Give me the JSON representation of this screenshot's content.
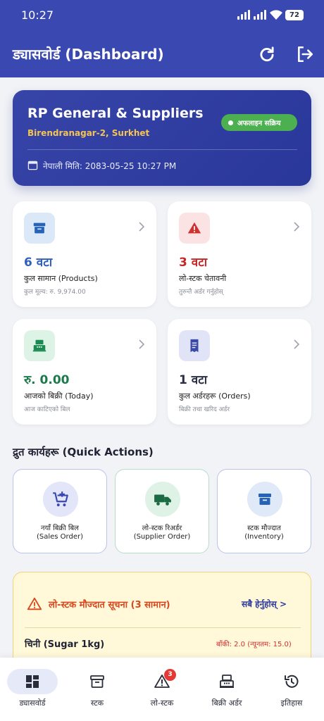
{
  "status_bar": {
    "time": "10:27",
    "battery": "72"
  },
  "header": {
    "title": "ड्यासवोर्ड (Dashboard)",
    "refresh_icon": "refresh-icon",
    "logout_icon": "logout-icon"
  },
  "business": {
    "name": "RP General & Suppliers",
    "address": "Birendranagar-2, Surkhet",
    "status": "अफलाइन सक्रिय",
    "date_label": "नेपाली मिति: 2083-05-25 10:27 PM"
  },
  "stats": [
    {
      "value": "6 वटा",
      "label": "कुल सामान (Products)",
      "sub": "कुल मूल्य: रु. 9,974.00",
      "color": "#2f5fb8",
      "icon": "archive-icon"
    },
    {
      "value": "3 वटा",
      "label": "लो-स्टक चेतावनी",
      "sub": "तुरुन्तै अर्डर गर्नुहोस्",
      "color": "#c62828",
      "icon": "warning-icon"
    },
    {
      "value": "रु. 0.00",
      "label": "आजको बिक्री (Today)",
      "sub": "आज काटिएको बिल",
      "color": "#1b7a4a",
      "icon": "cash-register-icon"
    },
    {
      "value": "1 वटा",
      "label": "कुल अर्डरहरू (Orders)",
      "sub": "बिक्री तथा खरिद अर्डर",
      "color": "#2a2f45",
      "icon": "receipt-icon"
    }
  ],
  "quick_actions": {
    "title": "द्रुत कार्यहरू (Quick Actions)",
    "items": [
      {
        "line1": "नयाँ बिक्री बिल",
        "line2": "(Sales Order)",
        "icon": "add-cart-icon"
      },
      {
        "line1": "लो-स्टक रिअर्डर",
        "line2": "(Supplier Order)",
        "icon": "truck-icon"
      },
      {
        "line1": "स्टक मौज्दात",
        "line2": "(Inventory)",
        "icon": "archive-icon"
      }
    ]
  },
  "low_stock": {
    "title": "लो-स्टक मौज्दात सूचना (3 सामान)",
    "view_all": "सबै हेर्नुहोस् >",
    "item_name": "चिनी (Sugar 1kg)",
    "item_remaining": "बाँकी: 2.0 (न्यूनतम: 15.0)"
  },
  "nav": {
    "items": [
      {
        "label": "ड्यासवोर्ड",
        "icon": "dashboard-icon"
      },
      {
        "label": "स्टक",
        "icon": "archive-icon"
      },
      {
        "label": "लो-स्टक",
        "icon": "warning-icon",
        "badge": "3"
      },
      {
        "label": "बिक्री अर्डर",
        "icon": "cash-register-icon"
      },
      {
        "label": "इतिहास",
        "icon": "history-icon"
      }
    ]
  },
  "colors": {
    "primary": "#3a49b1",
    "accent_yellow": "#f5c451",
    "online": "#4caf50",
    "danger": "#d8471d"
  }
}
